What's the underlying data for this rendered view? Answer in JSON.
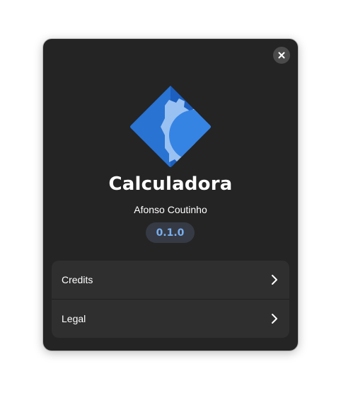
{
  "dialog": {
    "close_icon": "close-icon",
    "app_icon": "calculator-app-icon",
    "app_name": "Calculadora",
    "developer": "Afonso Coutinho",
    "version": "0.1.0",
    "rows": [
      {
        "label": "Credits",
        "icon": "chevron-right-icon"
      },
      {
        "label": "Legal",
        "icon": "chevron-right-icon"
      }
    ]
  },
  "colors": {
    "dialog_bg": "#242424",
    "list_bg": "#2f2f2f",
    "accent": "#78aeed",
    "icon_dark_blue": "#1c5fbf",
    "icon_mid_blue": "#3584e4",
    "icon_light_blue": "#99c1f1"
  }
}
